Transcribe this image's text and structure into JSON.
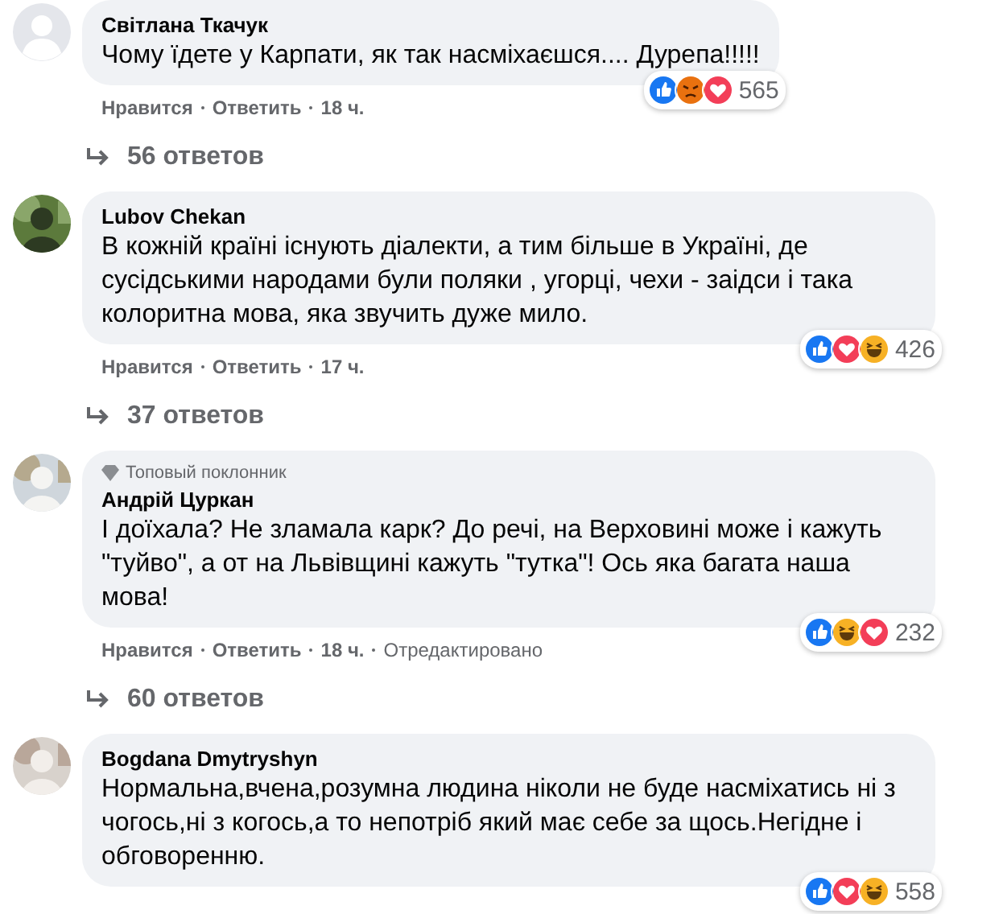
{
  "comments": [
    {
      "avatar": {
        "kind": "default"
      },
      "author": "Світлана Ткачук",
      "text": "Чому їдете у Карпати, як так насміхаєшся.... Дурепа!!!!!",
      "reactions": [
        {
          "kind": "like"
        },
        {
          "kind": "angry"
        },
        {
          "kind": "love"
        }
      ],
      "reaction_count": "565",
      "actions": {
        "like": "Нравится",
        "reply": "Ответить",
        "time": "18 ч."
      },
      "replies": "56 ответов"
    },
    {
      "avatar": {
        "kind": "picture"
      },
      "author": "Lubov Chekan",
      "text": "В кожній країні існують діалекти, а тим більше в Україні, де сусідськими народами були поляки , угорці, чехи - заідси і така колоритна мова, яка звучить дуже мило.",
      "reactions": [
        {
          "kind": "like"
        },
        {
          "kind": "love"
        },
        {
          "kind": "haha"
        }
      ],
      "reaction_count": "426",
      "actions": {
        "like": "Нравится",
        "reply": "Ответить",
        "time": "17 ч."
      },
      "replies": "37 ответов"
    },
    {
      "avatar": {
        "kind": "picture"
      },
      "badge": "Топовый поклонник",
      "author": "Андрій Цуркан",
      "text": "І доїхала? Не зламала карк? До речі, на Верховині може і кажуть \"туйво\", а от на Львівщині кажуть \"тутка\"! Ось яка багата наша мова!",
      "reactions": [
        {
          "kind": "like"
        },
        {
          "kind": "haha"
        },
        {
          "kind": "love"
        }
      ],
      "reaction_count": "232",
      "actions": {
        "like": "Нравится",
        "reply": "Ответить",
        "time": "18 ч.",
        "edited": "Отредактировано"
      },
      "replies": "60 ответов"
    },
    {
      "avatar": {
        "kind": "picture"
      },
      "author": "Bogdana Dmytryshyn",
      "text": "Нормальна,вчена,розумна людина ніколи не буде насміхатись ні з чогось,ні з когось,а то непотріб який має себе за щось.Негідне і обговоренню.",
      "reactions": [
        {
          "kind": "like"
        },
        {
          "kind": "love"
        },
        {
          "kind": "haha"
        }
      ],
      "reaction_count": "558"
    }
  ]
}
